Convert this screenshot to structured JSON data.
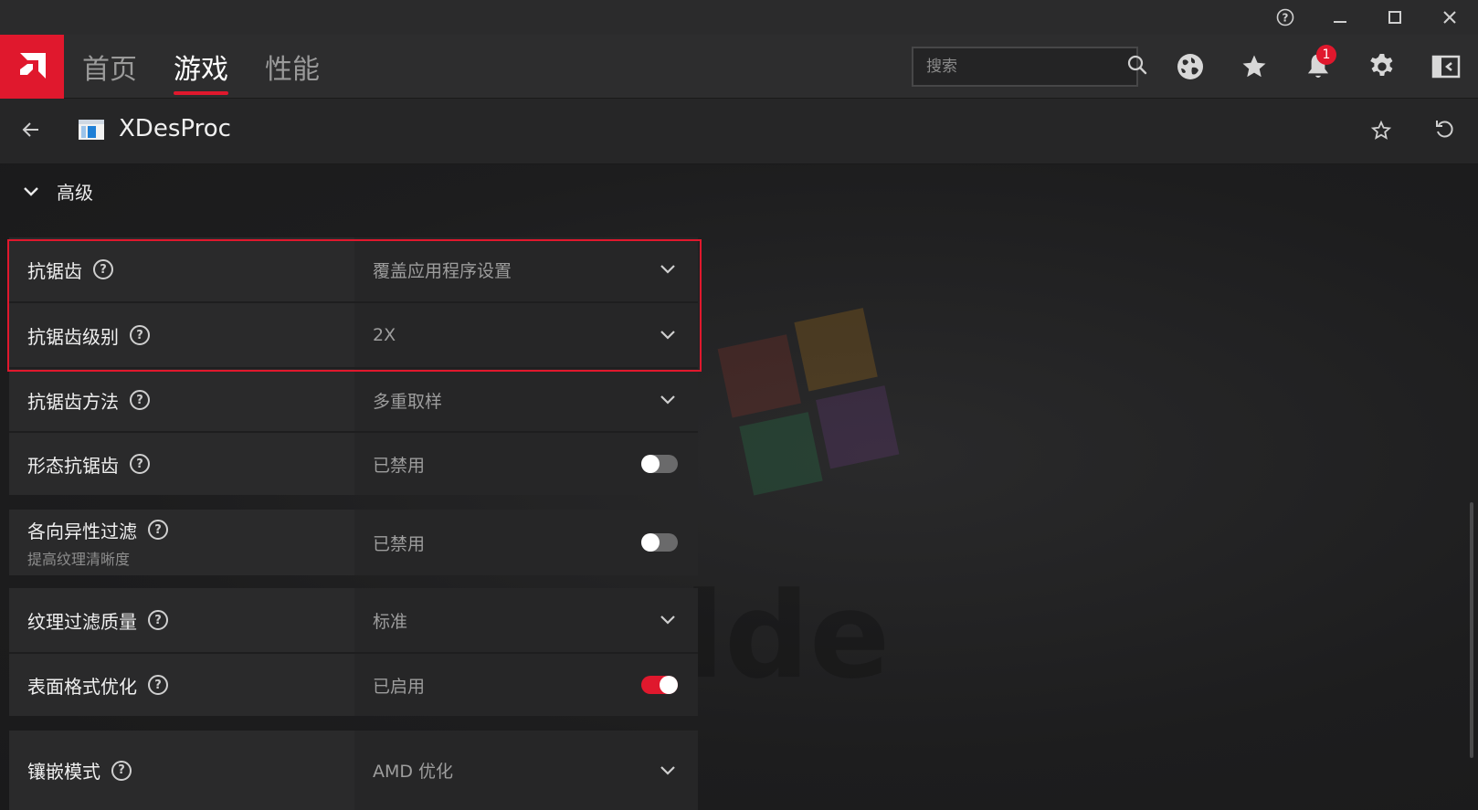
{
  "titlebar": {
    "help_icon": "help-circle-icon",
    "minimize_icon": "minimize-icon",
    "maximize_icon": "maximize-icon",
    "close_icon": "close-icon"
  },
  "nav": {
    "tabs": [
      {
        "label": "首页",
        "active": false
      },
      {
        "label": "游戏",
        "active": true
      },
      {
        "label": "性能",
        "active": false
      }
    ],
    "search_placeholder": "搜索",
    "notification_count": "1",
    "accent_color": "#e0182d"
  },
  "subheader": {
    "app_name": "XDesProc"
  },
  "section": {
    "title": "高级"
  },
  "settings": [
    {
      "label": "抗锯齿",
      "value": "覆盖应用程序设置",
      "control": "dropdown"
    },
    {
      "label": "抗锯齿级别",
      "value": "2X",
      "control": "dropdown"
    },
    {
      "label": "抗锯齿方法",
      "value": "多重取样",
      "control": "dropdown"
    },
    {
      "label": "形态抗锯齿",
      "value": "已禁用",
      "control": "toggle",
      "on": false
    },
    {
      "label": "各向异性过滤",
      "sublabel": "提高纹理清晰度",
      "value": "已禁用",
      "control": "toggle",
      "on": false
    },
    {
      "label": "纹理过滤质量",
      "value": "标准",
      "control": "dropdown"
    },
    {
      "label": "表面格式优化",
      "value": "已启用",
      "control": "toggle",
      "on": true
    },
    {
      "label": "镶嵌模式",
      "value": "AMD 优化",
      "control": "dropdown"
    }
  ]
}
